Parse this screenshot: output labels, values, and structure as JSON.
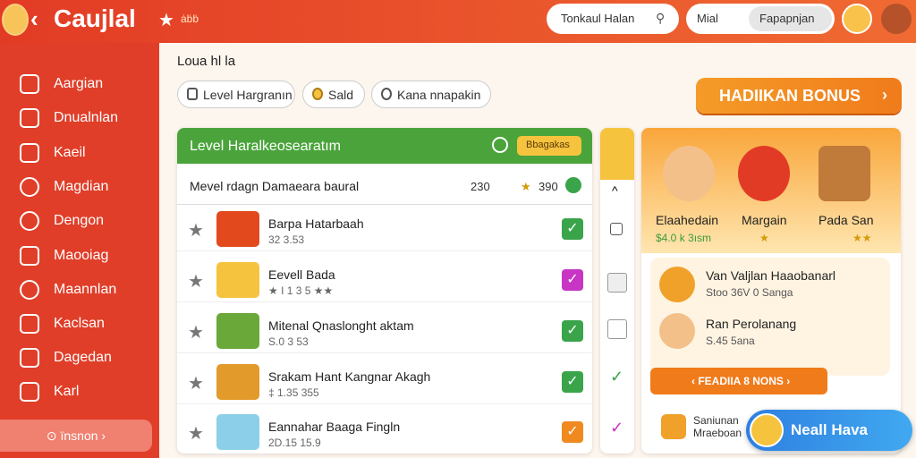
{
  "app": {
    "title": "Caujlal",
    "subtitle": "ȧḃḃ",
    "back_icon": "chevron-left-icon"
  },
  "topbar": {
    "search_label": "Tonkaul Halan",
    "segment_a": "Mial",
    "segment_b": "Fapapnjan"
  },
  "sidebar": {
    "items": [
      {
        "label": "Aargian",
        "icon": "star-icon"
      },
      {
        "label": "Dnualnlan",
        "icon": "list-icon"
      },
      {
        "label": "Kaeil",
        "icon": "card-icon"
      },
      {
        "label": "Magdian",
        "icon": "clock-icon"
      },
      {
        "label": "Dengon",
        "icon": "link-icon"
      },
      {
        "label": "Maooiag",
        "icon": "image-icon"
      },
      {
        "label": "Maannlan",
        "icon": "search-icon"
      },
      {
        "label": "Kaclsan",
        "icon": "arrow-icon"
      },
      {
        "label": "Dagedan",
        "icon": "puzzle-icon"
      },
      {
        "label": "Karl",
        "icon": "bag-icon"
      }
    ],
    "footer_button": "⊙ ïnsnon ›"
  },
  "breadcrumb": "Loua hl la",
  "pills": [
    {
      "label": "Level Hargranın"
    },
    {
      "label": "Sald"
    },
    {
      "label": "Kana nnapakin"
    }
  ],
  "bonus_button": "HADIIKAN BONUS",
  "levels_panel": {
    "title": "Level Haralkeosearatım",
    "tag": "Bbagakas",
    "subtitle": "Mevel rdagn Damaeara baural",
    "stat_1": "230",
    "stat_2": "390",
    "rows": [
      {
        "name": "Barpa Hatarbaah",
        "value": "32 3.53",
        "check": "#3aa44a"
      },
      {
        "name": "Eevell Bada",
        "value": "★ I 1 3 5 ★★",
        "check": "#c834c4"
      },
      {
        "name": "Mitenal Qnaslonght aktam",
        "value": "S.0 3 53",
        "check": "#3aa44a"
      },
      {
        "name": "Srakam Hant Kangnar Akagh",
        "value": "‡ 1.35 355",
        "check": "#3aa44a"
      },
      {
        "name": "Eannahar Baaga Fingln",
        "value": "2D.15 15.9",
        "check": "#f08a1e"
      }
    ]
  },
  "right_panel": {
    "characters": [
      {
        "name": "Elaahedain",
        "value": "$4.0 k 3ısm"
      },
      {
        "name": "Margain",
        "value": "★"
      },
      {
        "name": "Pada San",
        "value": "★★"
      }
    ],
    "cards": [
      {
        "title": "Van Valjlan Haaobanarl",
        "sub": "Stoo 36V 0 Sanga"
      },
      {
        "title": "Ran Perolanang",
        "sub": "S.45 5ana"
      }
    ],
    "orange_button": "‹ FEADIIA 8 NONS ›",
    "bottom_card": "Saniunan Mraeboan"
  },
  "float_button": "Neall Hava",
  "colors": {
    "primary": "#e23b25",
    "green": "#4aa43b",
    "orange": "#f07b1b",
    "blue": "#2f7fe0",
    "yellow": "#f6c33e"
  }
}
